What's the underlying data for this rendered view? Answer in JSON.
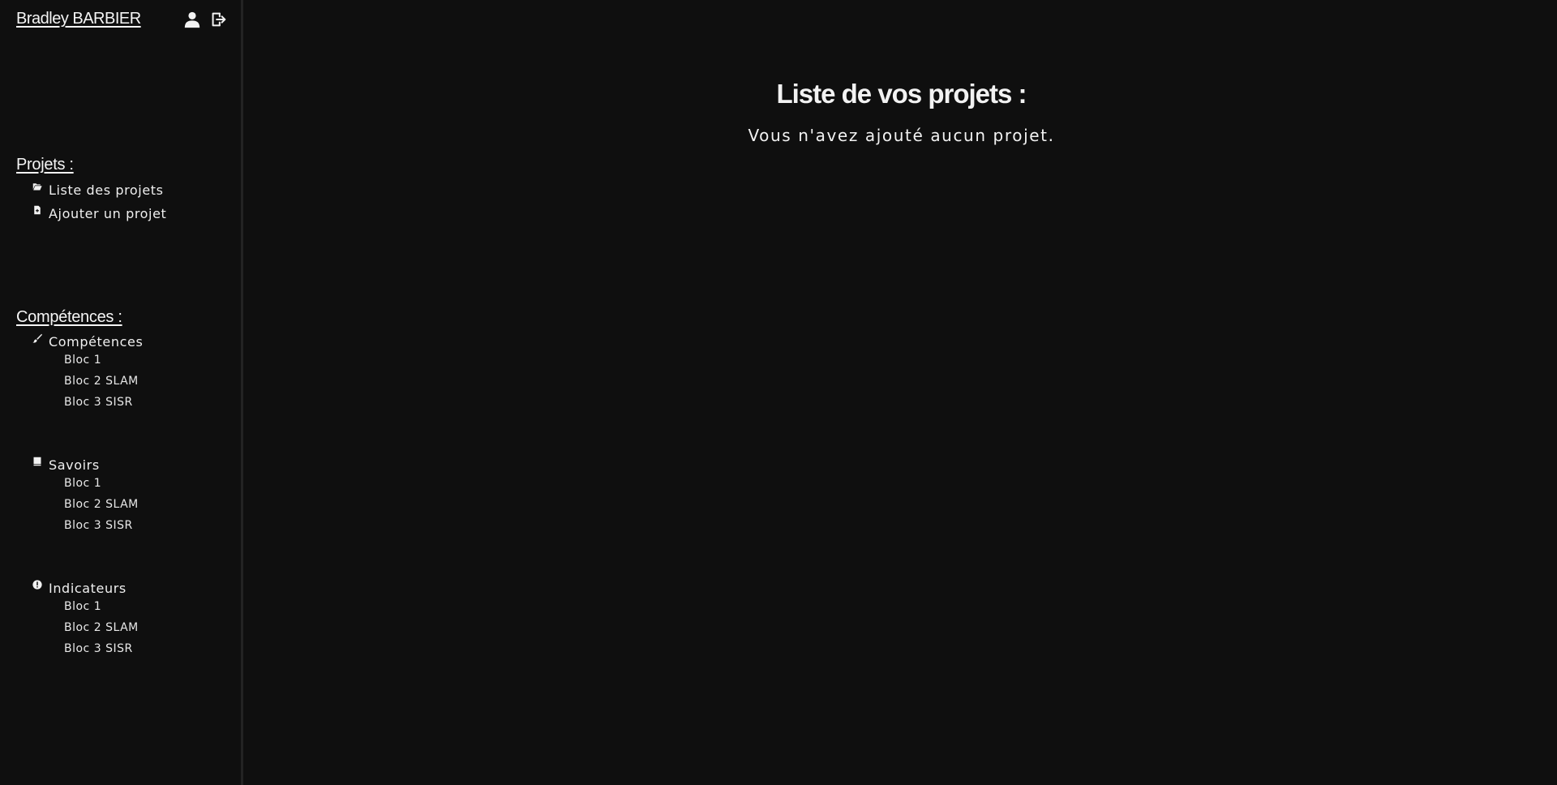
{
  "user": {
    "name": "Bradley BARBIER"
  },
  "sidebar": {
    "projects": {
      "title": "Projets :",
      "items": [
        {
          "label": "Liste des projets",
          "icon": "folder-open-icon"
        },
        {
          "label": "Ajouter un projet",
          "icon": "file-add-icon"
        }
      ]
    },
    "skills": {
      "title": "Compétences :",
      "groups": [
        {
          "label": "Compétences",
          "icon": "brush-icon",
          "items": [
            "Bloc 1",
            "Bloc 2 SLAM",
            "Bloc 3 SISR"
          ]
        },
        {
          "label": "Savoirs",
          "icon": "book-icon",
          "items": [
            "Bloc 1",
            "Bloc 2 SLAM",
            "Bloc 3 SISR"
          ]
        },
        {
          "label": "Indicateurs",
          "icon": "exclamation-circle-icon",
          "items": [
            "Bloc 1",
            "Bloc 2 SLAM",
            "Bloc 3 SISR"
          ]
        }
      ]
    }
  },
  "main": {
    "title": "Liste de vos projets :",
    "empty_message": "Vous n'avez ajouté aucun projet."
  },
  "colors": {
    "background": "#0f0f0f",
    "text": "#f2f2f2",
    "sidebar_border": "#232323"
  }
}
